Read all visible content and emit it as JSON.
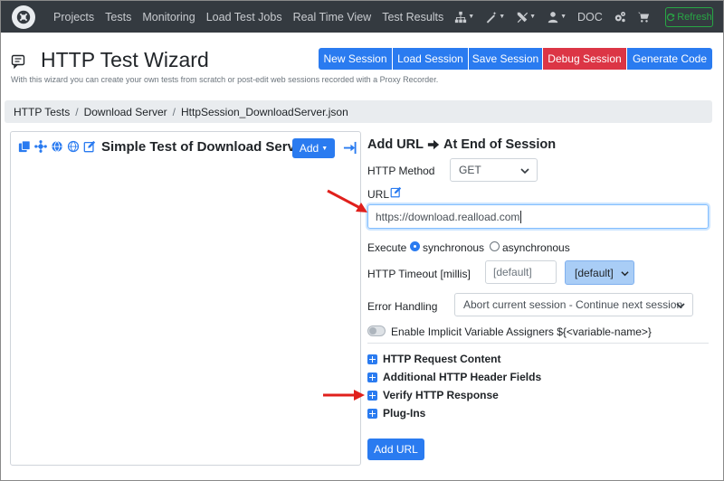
{
  "navbar": {
    "items": [
      "Projects",
      "Tests",
      "Monitoring",
      "Load Test Jobs",
      "Real Time View",
      "Test Results"
    ],
    "doc_label": "DOC",
    "refresh_label": "Refresh",
    "icons": [
      "sitemap-icon",
      "magic-wand-icon",
      "tools-icon",
      "user-icon",
      "cogs-icon",
      "cart-icon"
    ]
  },
  "header": {
    "title": "HTTP Test Wizard",
    "subtitle": "With this wizard you can create your own tests from scratch or post-edit web sessions recorded with a Proxy Recorder.",
    "buttons": [
      "New Session",
      "Load Session",
      "Save Session",
      "Debug Session",
      "Generate Code"
    ]
  },
  "breadcrumb": [
    "HTTP Tests",
    "Download Server",
    "HttpSession_DownloadServer.json"
  ],
  "left_panel": {
    "title": "Simple Test of Download Server",
    "add_label": "Add"
  },
  "right_panel": {
    "heading_left": "Add URL",
    "heading_right": "At End of Session",
    "http_method_label": "HTTP Method",
    "http_method_value": "GET",
    "url_label": "URL",
    "url_value": "https://download.realload.com",
    "execute_label": "Execute",
    "execute_options": [
      "synchronous",
      "asynchronous"
    ],
    "timeout_label": "HTTP Timeout [millis]",
    "timeout_placeholder": "[default]",
    "timeout_select": "[default]",
    "error_label": "Error Handling",
    "error_value": "Abort current session - Continue next session",
    "toggle_label": "Enable Implicit Variable Assigners ${<variable-name>}",
    "sections": [
      "HTTP Request Content",
      "Additional HTTP Header Fields",
      "Verify HTTP Response",
      "Plug-Ins"
    ],
    "add_url_label": "Add URL"
  },
  "colors": {
    "primary": "#2a7bf0",
    "danger": "#dc3545",
    "navbar": "#343a40",
    "refresh": "#28a745",
    "annotation_arrow": "#e0201c"
  }
}
